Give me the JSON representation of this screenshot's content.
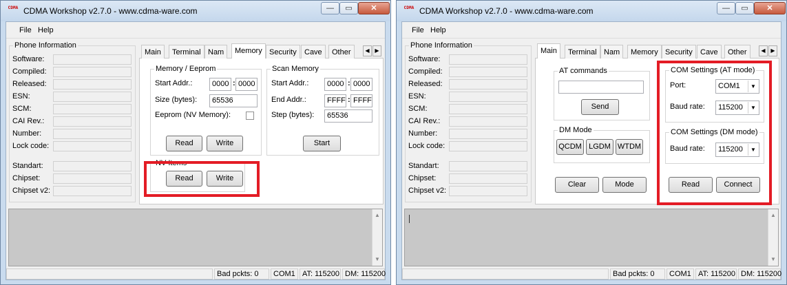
{
  "app": {
    "title": "CDMA Workshop v2.7.0  -  www.cdma-ware.com",
    "icon_text": "CDMA",
    "close_glyph": "✕",
    "min_glyph": "—",
    "max_glyph": "▭"
  },
  "menu": {
    "file": "File",
    "help": "Help"
  },
  "phone_info": {
    "legend": "Phone Information",
    "fields": [
      "Software:",
      "Compiled:",
      "Released:",
      "ESN:",
      "SCM:",
      "CAI Rev.:",
      "Number:",
      "Lock code:"
    ],
    "fields2": [
      "Standart:",
      "Chipset:",
      "Chipset v2:"
    ]
  },
  "tabs": [
    "Main",
    "Terminal",
    "Nam",
    "Memory",
    "Security",
    "Cave",
    "Other"
  ],
  "tab_nav": {
    "left": "◀",
    "right": "▶",
    "extra": "l"
  },
  "memory": {
    "mem_legend": "Memory / Eeprom",
    "start_addr_label": "Start Addr.:",
    "start_addr_hi": "0000",
    "start_addr_lo": "0000",
    "size_label": "Size (bytes):",
    "size_value": "65536",
    "eeprom_label": "Eeprom (NV Memory):",
    "read": "Read",
    "write": "Write",
    "scan_legend": "Scan Memory",
    "scan_start_label": "Start Addr.:",
    "scan_start_hi": "0000",
    "scan_start_lo": "0000",
    "end_addr_label": "End Addr.:",
    "end_addr_hi": "FFFF",
    "end_addr_lo": "FFFF",
    "step_label": "Step (bytes):",
    "step_value": "65536",
    "start": "Start",
    "nv_legend": "NV Items",
    "nv_read": "Read",
    "nv_write": "Write",
    "colon": ":"
  },
  "main": {
    "at_legend": "AT commands",
    "send": "Send",
    "dm_legend": "DM Mode",
    "qcdm": "QCDM",
    "lgdm": "LGDM",
    "wtdm": "WTDM",
    "clear": "Clear",
    "mode": "Mode",
    "com_at_legend": "COM Settings (AT mode)",
    "port_label": "Port:",
    "port_value": "COM1",
    "baud_label": "Baud rate:",
    "baud_value": "115200",
    "com_dm_legend": "COM Settings (DM mode)",
    "dm_baud_label": "Baud rate:",
    "dm_baud_value": "115200",
    "read": "Read",
    "connect": "Connect",
    "combo_arrow": "▼"
  },
  "log": {
    "up": "▲",
    "down": "▼"
  },
  "status": {
    "bad_packets": "Bad pckts: 0",
    "port": "COM1",
    "at": "AT: 115200",
    "dm": "DM: 115200"
  },
  "colors": {
    "highlight": "#e31c25",
    "title_bg": "#c9dbee"
  }
}
